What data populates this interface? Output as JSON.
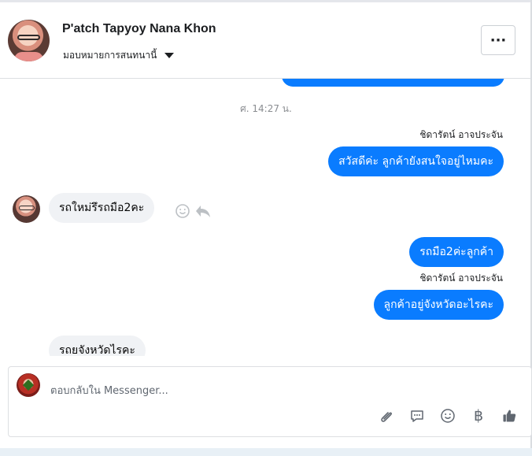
{
  "header": {
    "contact_name": "P'atch Tapyoy Nana Khon",
    "assign_label": "มอบหมายการสนทนานี้",
    "more_label": "···"
  },
  "messages": {
    "time_label": "ศ. 14:27 น.",
    "sender_1": "ชิดารัตน์ อาจประจัน",
    "out_1": "สวัสดีค่ะ ลูกค้ายังสนใจอยู่ไหมคะ",
    "in_1": "รถใหม่รึรถมือ2คะ",
    "out_2": "รถมือ2ค่ะลูกค้า",
    "sender_2": "ชิดารัตน์ อาจประจัน",
    "out_3": "ลูกค้าอยู่จังหวัดอะไรคะ",
    "in_2": "รถยจังหวัดไรคะ"
  },
  "composer": {
    "placeholder": "ตอบกลับใน Messenger...",
    "tools": [
      "paperclip-icon",
      "comment-icon",
      "smile-icon",
      "baht-icon",
      "thumbs-up-icon"
    ],
    "currency_symbol": "฿"
  },
  "colors": {
    "messenger_blue": "#0a7cff",
    "incoming_bubble": "#f0f2f5",
    "text_primary": "#050505"
  }
}
